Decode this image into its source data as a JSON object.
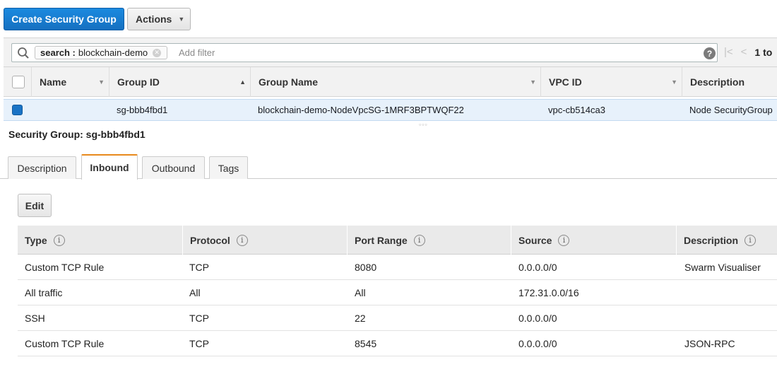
{
  "toolbar": {
    "create_label": "Create Security Group",
    "actions_label": "Actions",
    "accent": "#1570c0"
  },
  "filter": {
    "chip_key": "search :",
    "chip_value": "blockchain-demo",
    "placeholder": "Add filter",
    "pager_text": "1 to"
  },
  "grid": {
    "columns": [
      "Name",
      "Group ID",
      "Group Name",
      "VPC ID",
      "Description"
    ],
    "row": {
      "selected": true,
      "name": "",
      "group_id": "sg-bbb4fbd1",
      "group_name": "blockchain-demo-NodeVpcSG-1MRF3BPTWQF22",
      "vpc_id": "vpc-cb514ca3",
      "description": "Node SecurityGroup"
    }
  },
  "detail": {
    "title": "Security Group: sg-bbb4fbd1",
    "tabs": [
      "Description",
      "Inbound",
      "Outbound",
      "Tags"
    ],
    "active_tab": "Inbound",
    "edit_label": "Edit"
  },
  "rules": {
    "columns": [
      "Type",
      "Protocol",
      "Port Range",
      "Source",
      "Description"
    ],
    "rows": [
      {
        "type": "Custom TCP Rule",
        "protocol": "TCP",
        "port": "8080",
        "source": "0.0.0.0/0",
        "description": "Swarm Visualiser"
      },
      {
        "type": "All traffic",
        "protocol": "All",
        "port": "All",
        "source": "172.31.0.0/16",
        "description": ""
      },
      {
        "type": "SSH",
        "protocol": "TCP",
        "port": "22",
        "source": "0.0.0.0/0",
        "description": ""
      },
      {
        "type": "Custom TCP Rule",
        "protocol": "TCP",
        "port": "8545",
        "source": "0.0.0.0/0",
        "description": "JSON-RPC"
      }
    ]
  }
}
